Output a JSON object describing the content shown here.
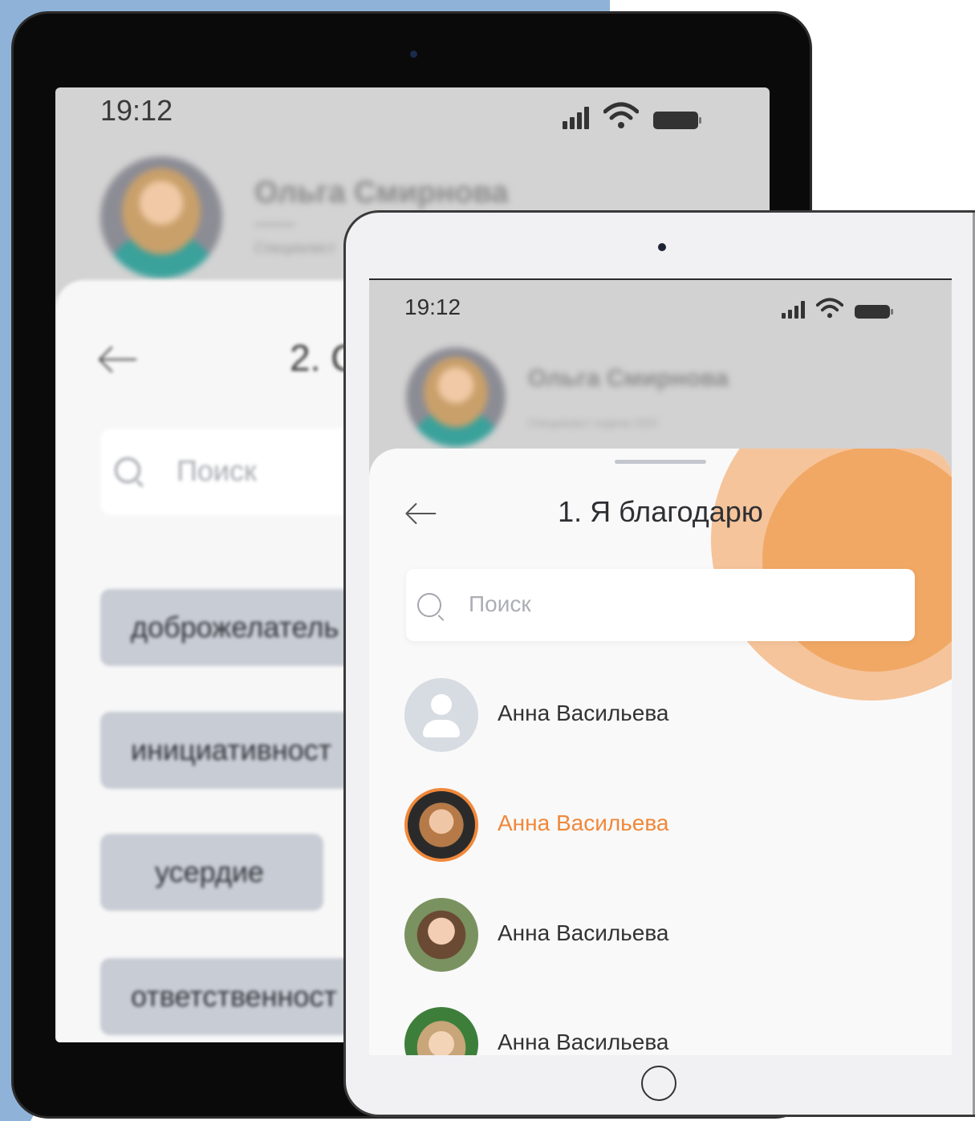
{
  "back_tablet": {
    "status_time": "19:12",
    "profile_name": "Ольга Смирнова",
    "profile_role": "Специалист",
    "sheet_title": "2. С",
    "search_placeholder": "Поиск",
    "chips": [
      "доброжелатель",
      "инициативност",
      "усердие",
      "ответственност"
    ]
  },
  "front_tablet": {
    "status_time": "19:12",
    "profile_name": "Ольга Смирнова",
    "profile_role": "Специалист отдела CEO",
    "sheet_title": "1. Я благодарю",
    "search_placeholder": "Поиск",
    "contacts": [
      {
        "name": "Анна Васильева",
        "avatar": "placeholder",
        "selected": false
      },
      {
        "name": "Анна Васильева",
        "avatar": "photo",
        "selected": true
      },
      {
        "name": "Анна Васильева",
        "avatar": "photo",
        "selected": false
      },
      {
        "name": "Анна Васильева",
        "avatar": "photo",
        "selected": false
      }
    ]
  },
  "colors": {
    "accent_orange": "#f0883a",
    "orange_light": "#f5c49b",
    "orange_mid": "#f1a865",
    "backdrop_blue": "#8fb3d8",
    "chip_gray": "#c8ccd4"
  },
  "icons": [
    "signal-icon",
    "wifi-icon",
    "battery-icon",
    "back-arrow-icon",
    "search-icon",
    "user-placeholder-icon",
    "home-button"
  ]
}
